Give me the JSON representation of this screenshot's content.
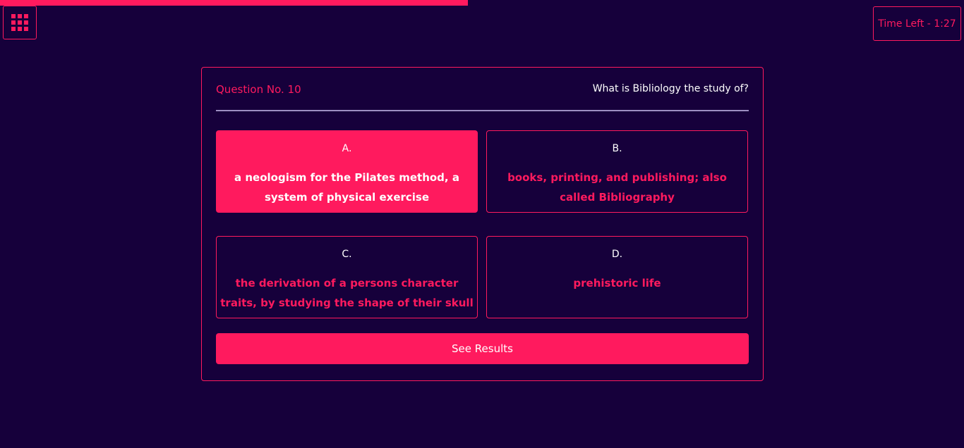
{
  "progress": {
    "fraction": 0.485,
    "color": "#ff1a5e"
  },
  "menu": {
    "icon": "grid-menu-icon"
  },
  "timer": {
    "label": "Time Left - 1:27"
  },
  "question": {
    "number_label": "Question No. 10",
    "text": "What is Bibliology the study of?"
  },
  "options": [
    {
      "letter": "A.",
      "text": "a neologism for the Pilates method, a system of physical exercise",
      "selected": true
    },
    {
      "letter": "B.",
      "text": "books, printing, and publishing; also called Bibliography",
      "selected": false
    },
    {
      "letter": "C.",
      "text": "the derivation of a persons character traits, by studying the shape of their skull",
      "selected": false
    },
    {
      "letter": "D.",
      "text": "prehistoric life",
      "selected": false
    }
  ],
  "results_button": {
    "label": "See Results"
  },
  "colors": {
    "background": "#16003b",
    "accent": "#ff1a5e",
    "divider": "#9d8fc2"
  }
}
